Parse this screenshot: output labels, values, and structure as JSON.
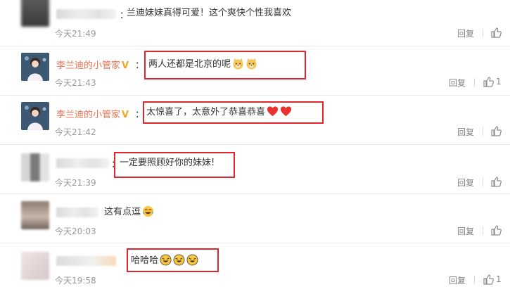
{
  "comments": [
    {
      "name": "",
      "verified": false,
      "text": "兰迪妹妹真得可爱！这个爽快个性我喜欢",
      "emojis": [],
      "time": "今天21:49",
      "reply": "回复",
      "likes": ""
    },
    {
      "name": "李兰迪的小管家",
      "verified": true,
      "text": "两人还都是北京的呢",
      "emojis": [
        "doge-emoji",
        "doge-emoji"
      ],
      "time": "今天21:43",
      "reply": "回复",
      "likes": "1"
    },
    {
      "name": "李兰迪的小管家",
      "verified": true,
      "text": "太惊喜了，太意外了恭喜恭喜",
      "emojis": [
        "heart-emoji",
        "heart-emoji"
      ],
      "time": "今天21:42",
      "reply": "回复",
      "likes": ""
    },
    {
      "name": "",
      "verified": false,
      "text": "一定要照顾好你的妹妹!",
      "emojis": [],
      "time": "今天21:39",
      "reply": "回复",
      "likes": ""
    },
    {
      "name": "",
      "verified": false,
      "text": "这有点逗",
      "emojis": [
        "laugh-cry-emoji"
      ],
      "time": "今天20:03",
      "reply": "回复",
      "likes": ""
    },
    {
      "name": "",
      "verified": false,
      "text": "哈哈哈",
      "emojis": [
        "rofl-emoji",
        "rofl-emoji",
        "rofl-emoji"
      ],
      "time": "今天19:58",
      "reply": "回复",
      "likes": "1"
    }
  ],
  "verified_badge": "V",
  "colors": {
    "name": "#eb7350",
    "highlight": "#e0262f",
    "meta": "#999999",
    "badge": "#f5a623"
  }
}
